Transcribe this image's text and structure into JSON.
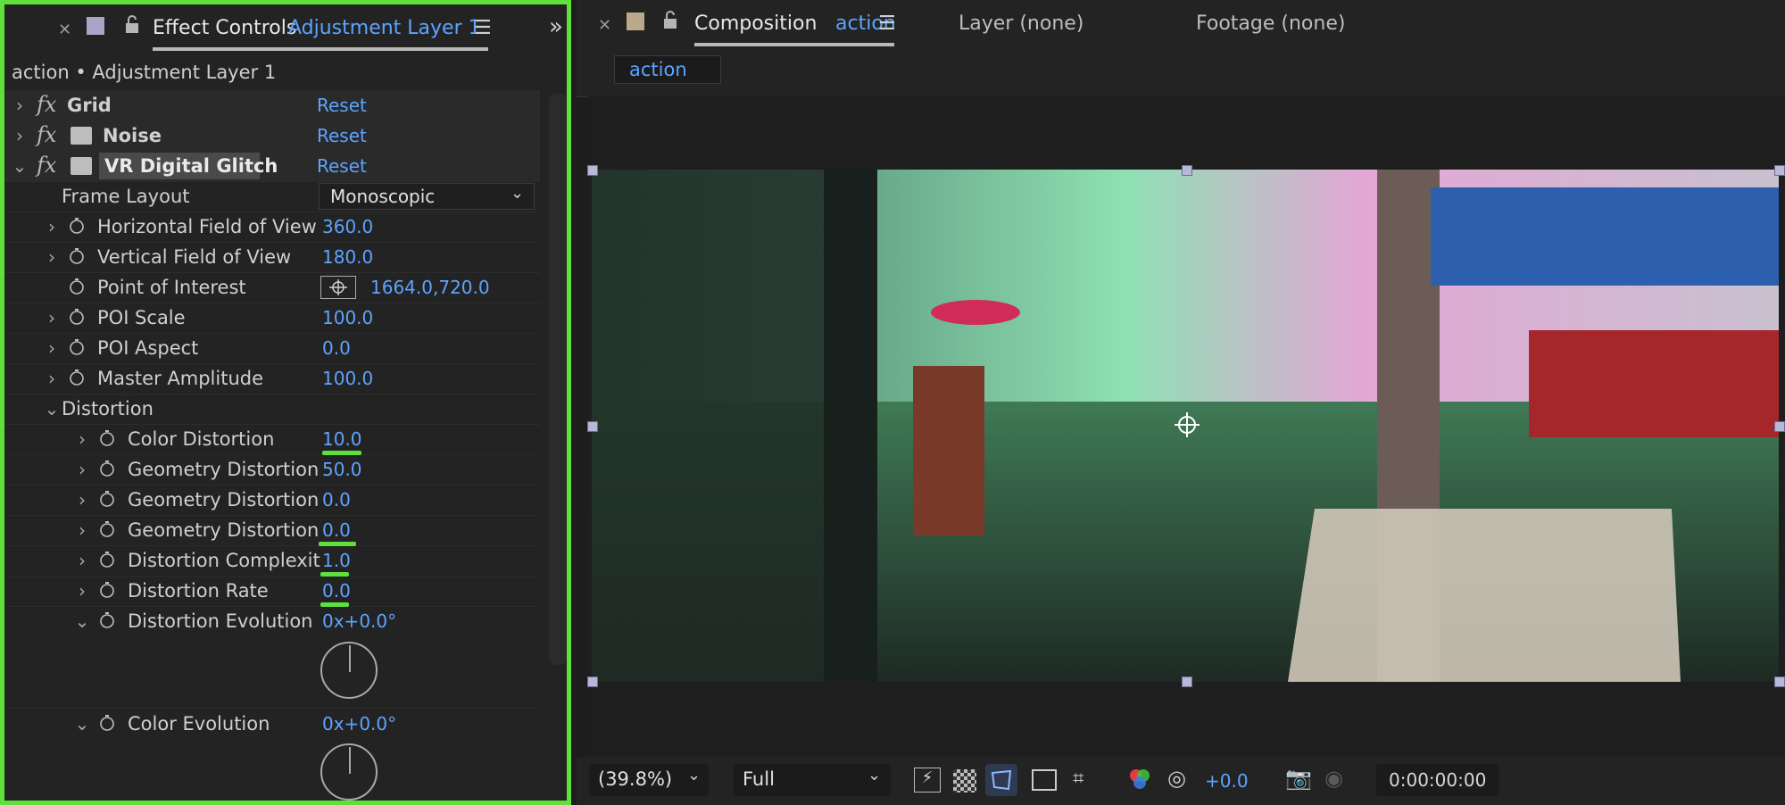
{
  "effect_controls": {
    "tab_prefix": "Effect Controls",
    "tab_layer": "Adjustment Layer 1",
    "breadcrumb": "action • Adjustment Layer 1",
    "effects": [
      {
        "name": "Grid",
        "reset": "Reset"
      },
      {
        "name": "Noise",
        "reset": "Reset"
      },
      {
        "name": "VR Digital Glitch",
        "reset": "Reset"
      }
    ],
    "frame_layout": {
      "label": "Frame Layout",
      "value": "Monoscopic"
    },
    "params": [
      {
        "label": "Horizontal Field of View",
        "value": "360.0"
      },
      {
        "label": "Vertical Field of View",
        "value": "180.0"
      },
      {
        "label": "Point of Interest",
        "value": "1664.0,720.0"
      },
      {
        "label": "POI Scale",
        "value": "100.0"
      },
      {
        "label": "POI Aspect",
        "value": "0.0"
      },
      {
        "label": "Master Amplitude",
        "value": "100.0"
      }
    ],
    "group": "Distortion",
    "distortion_params": [
      {
        "label": "Color Distortion",
        "value": "10.0"
      },
      {
        "label": "Geometry Distortion",
        "value": "50.0"
      },
      {
        "label": "Geometry Distortion",
        "value": "0.0"
      },
      {
        "label": "Geometry Distortion",
        "value": "0.0"
      },
      {
        "label": "Distortion Complexit",
        "value": "1.0"
      },
      {
        "label": "Distortion Rate",
        "value": "0.0"
      },
      {
        "label": "Distortion Evolution",
        "value": "0x+0.0°"
      },
      {
        "label": "Color Evolution",
        "value": "0x+0.0°"
      }
    ]
  },
  "composition": {
    "tab_prefix": "Composition",
    "tab_name": "action",
    "layer_tab": "Layer (none)",
    "footage_tab": "Footage (none)",
    "sub_tab": "action"
  },
  "bottom_bar": {
    "zoom": "(39.8%)",
    "resolution": "Full",
    "exposure": "+0.0",
    "timecode": "0:00:00:00"
  },
  "colors": {
    "highlight": "#5fe03a",
    "value_blue": "#5da3ff"
  }
}
